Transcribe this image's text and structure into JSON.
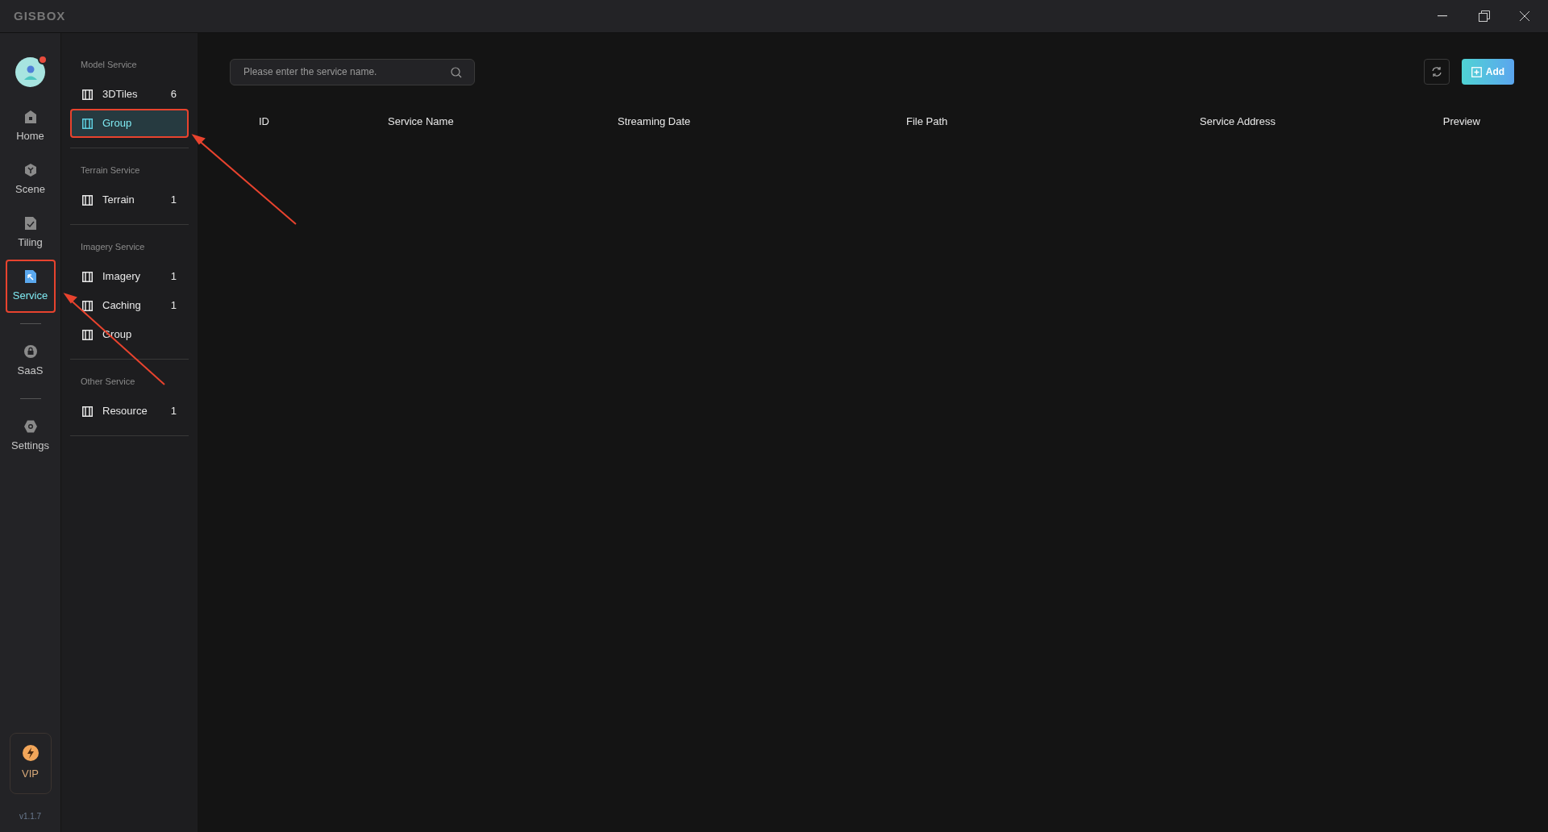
{
  "app": {
    "logo": "GISBOX",
    "version": "v1.1.7"
  },
  "nav": [
    {
      "kind": "home",
      "label": "Home",
      "selected": false,
      "highlighted": false
    },
    {
      "kind": "scene",
      "label": "Scene",
      "selected": false,
      "highlighted": false
    },
    {
      "kind": "tiling",
      "label": "Tiling",
      "selected": false,
      "highlighted": false
    },
    {
      "kind": "service",
      "label": "Service",
      "selected": true,
      "highlighted": true
    },
    {
      "kind": "divider"
    },
    {
      "kind": "saas",
      "label": "SaaS",
      "selected": false,
      "highlighted": false
    },
    {
      "kind": "divider"
    },
    {
      "kind": "settings",
      "label": "Settings",
      "selected": false,
      "highlighted": false
    }
  ],
  "vip": {
    "label": "VIP"
  },
  "sections": [
    {
      "title": "Model Service",
      "items": [
        {
          "label": "3DTiles",
          "count": "6",
          "selected": false,
          "highlighted": false
        },
        {
          "label": "Group",
          "selected": true,
          "highlighted": true
        }
      ]
    },
    {
      "title": "Terrain Service",
      "items": [
        {
          "label": "Terrain",
          "count": "1",
          "selected": false,
          "highlighted": false
        }
      ]
    },
    {
      "title": "Imagery Service",
      "items": [
        {
          "label": "Imagery",
          "count": "1",
          "selected": false,
          "highlighted": false
        },
        {
          "label": "Caching",
          "count": "1",
          "selected": false,
          "highlighted": false
        },
        {
          "label": "Group",
          "selected": false,
          "highlighted": false
        }
      ]
    },
    {
      "title": "Other Service",
      "items": [
        {
          "label": "Resource",
          "count": "1",
          "selected": false,
          "highlighted": false
        }
      ]
    }
  ],
  "search": {
    "placeholder": "Please enter the service name."
  },
  "add_button": "Add",
  "table": {
    "columns": [
      "ID",
      "Service Name",
      "Streaming Date",
      "File Path",
      "Service Address",
      "Preview"
    ]
  }
}
